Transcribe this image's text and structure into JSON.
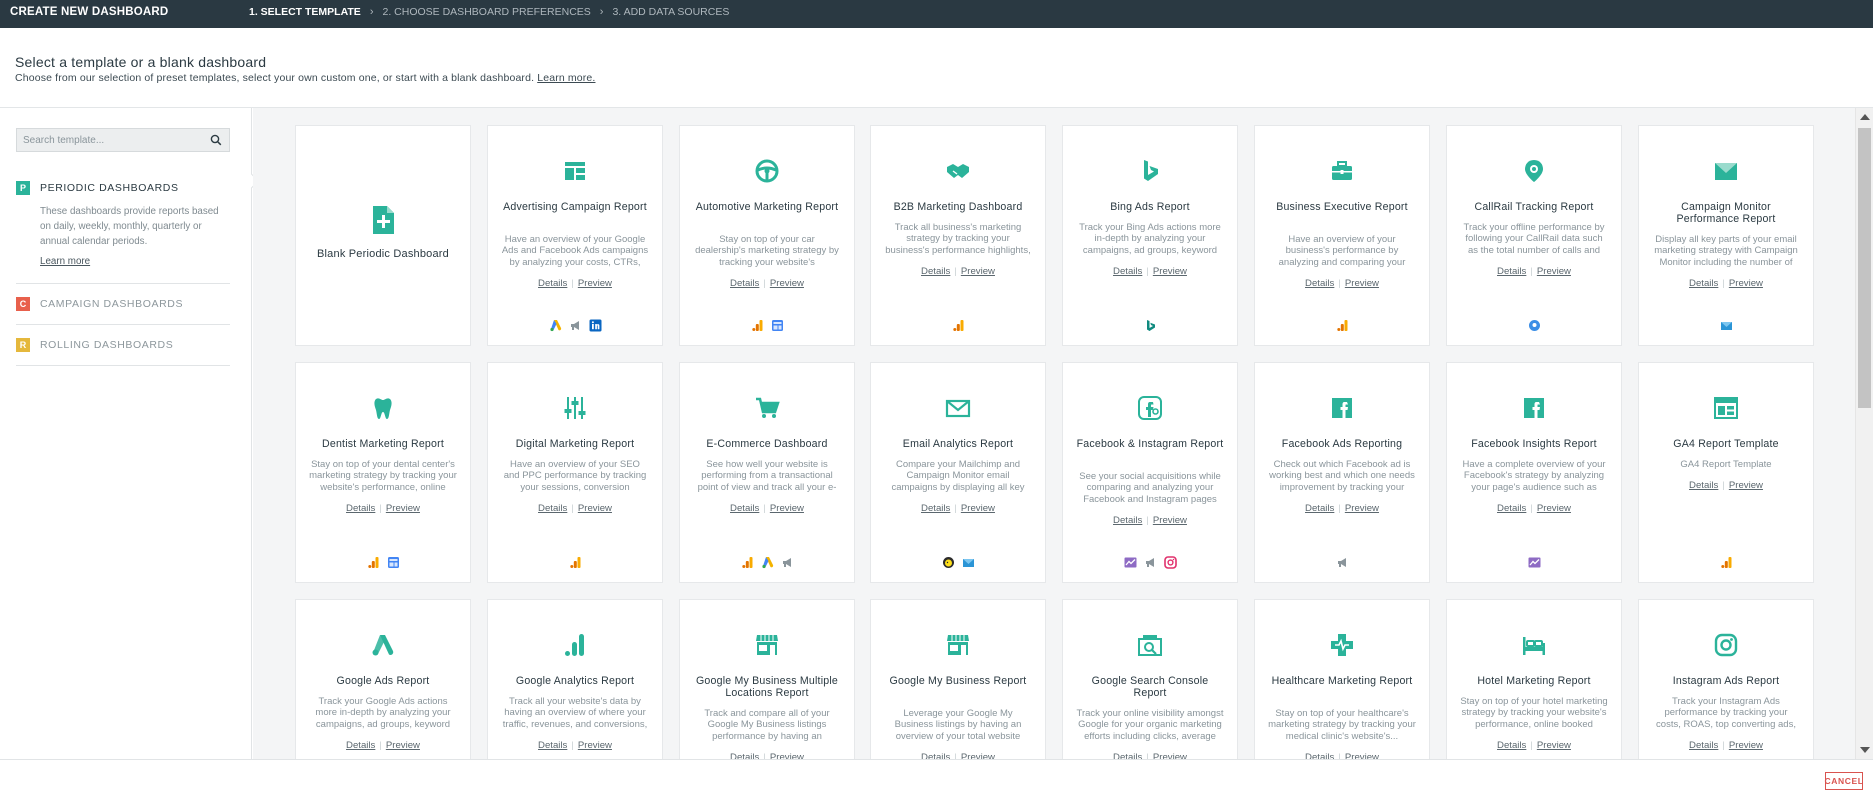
{
  "topbar": {
    "title": "CREATE NEW DASHBOARD",
    "steps": [
      "1. SELECT TEMPLATE",
      "2. CHOOSE DASHBOARD PREFERENCES",
      "3. ADD DATA SOURCES"
    ]
  },
  "header": {
    "heading": "Select a template or a blank dashboard",
    "subheading": "Choose from our selection of preset templates, select your own custom one, or start with a blank dashboard.",
    "learn_more": "Learn more."
  },
  "sidebar": {
    "search_placeholder": "Search template...",
    "categories": [
      {
        "badge": "P",
        "label": "PERIODIC DASHBOARDS",
        "color": "#2bb39a",
        "desc": "These dashboards provide reports based on daily, weekly, monthly, quarterly or annual calendar periods.",
        "learn": "Learn more"
      },
      {
        "badge": "C",
        "label": "CAMPAIGN DASHBOARDS",
        "color": "#e8604c"
      },
      {
        "badge": "R",
        "label": "ROLLING DASHBOARDS",
        "color": "#e5b83c"
      }
    ]
  },
  "colors": {
    "accent": "#2bb39a",
    "topbar": "#2a3942",
    "cancel": "#d9534f"
  },
  "links": {
    "details": "Details",
    "preview": "Preview"
  },
  "blank": {
    "title": "Blank Periodic Dashboard",
    "icon": "file-plus-icon"
  },
  "templates": [
    {
      "title": "Advertising Campaign Report",
      "desc": "Have an overview of your Google Ads and Facebook Ads campaigns by analyzing your costs, CTRs, conversion rates...",
      "icon": "dashboard-layout-icon",
      "sources": [
        "google-ads",
        "megaphone",
        "linkedin"
      ]
    },
    {
      "title": "Automotive Marketing Report",
      "desc": "Stay on top of your car dealership's marketing strategy by tracking your website's performance, lead acquisition...",
      "icon": "steering-wheel-icon",
      "sources": [
        "analytics",
        "gmb"
      ]
    },
    {
      "title": "B2B Marketing Dashboard",
      "desc": "Track all business's marketing strategy by tracking your business's performance highlights, your website's...",
      "icon": "handshake-icon",
      "sources": [
        "analytics"
      ]
    },
    {
      "title": "Bing Ads Report",
      "desc": "Track your Bing Ads actions more in-depth by analyzing your campaigns, ad groups, keyword performance and...",
      "icon": "bing-icon",
      "sources": [
        "bing"
      ]
    },
    {
      "title": "Business Executive Report",
      "desc": "Have an overview of your business's performance by analyzing and comparing your most important metrics and...",
      "icon": "briefcase-icon",
      "sources": [
        "analytics"
      ]
    },
    {
      "title": "CallRail Tracking Report",
      "desc": "Track your offline performance by following your CallRail data such as the total number of calls and answered calls, the...",
      "icon": "map-pin-icon",
      "sources": [
        "callrail"
      ]
    },
    {
      "title": "Campaign Monitor Performance Report",
      "desc": "Display all key parts of your email marketing strategy with Campaign Monitor including the number of emails sent,...",
      "icon": "campaign-monitor-icon",
      "sources": [
        "campaign-monitor"
      ]
    },
    {
      "title": "Dentist Marketing Report",
      "desc": "Stay on top of your dental center's marketing strategy by tracking your website's performance, online booked...",
      "icon": "tooth-icon",
      "sources": [
        "analytics",
        "gmb"
      ]
    },
    {
      "title": "Digital Marketing Report",
      "desc": "Have an overview of your SEO and PPC performance by tracking your sessions, conversion revenue, costs and...",
      "icon": "sliders-icon",
      "sources": [
        "analytics"
      ]
    },
    {
      "title": "E-Commerce Dashboard",
      "desc": "See how well your website is performing from a transactional point of view and track all your e-commerce dat...",
      "icon": "shopping-cart-icon",
      "sources": [
        "analytics",
        "google-ads",
        "megaphone"
      ]
    },
    {
      "title": "Email Analytics Report",
      "desc": "Compare your Mailchimp and Campaign Monitor email campaigns by displaying all key parts of your email marketing...",
      "icon": "envelope-icon",
      "sources": [
        "mailchimp",
        "campaign-monitor"
      ]
    },
    {
      "title": "Facebook & Instagram Report",
      "desc": "See your social acquisitions while comparing and analyzing your Facebook and Instagram pages performances such as...",
      "icon": "facebook-instagram-icon",
      "sources": [
        "insights",
        "megaphone",
        "instagram"
      ]
    },
    {
      "title": "Facebook Ads Reporting",
      "desc": "Check out which Facebook ad is working best and which one needs improvement by tracking your campaigns...",
      "icon": "facebook-icon",
      "sources": [
        "megaphone"
      ]
    },
    {
      "title": "Facebook Insights Report",
      "desc": "Have a complete overview of your Facebook's strategy by analyzing your page's audience such as engagement rates,...",
      "icon": "facebook-icon",
      "sources": [
        "insights"
      ]
    },
    {
      "title": "GA4 Report Template",
      "desc": "GA4 Report Template",
      "icon": "ga4-layout-icon",
      "sources": [
        "analytics"
      ]
    },
    {
      "title": "Google Ads Report",
      "desc": "Track your Google Ads actions more in-depth by analyzing your campaigns, ad groups, keyword performance and...",
      "icon": "google-ads-icon",
      "sources": []
    },
    {
      "title": "Google Analytics Report",
      "desc": "Track all your website's data by having an overview of where your traffic, revenues, and conversions, including your to...",
      "icon": "google-analytics-icon",
      "sources": []
    },
    {
      "title": "Google My Business Multiple Locations Report",
      "desc": "Track and compare all of your Google My Business listings performance by having an overview of your insights such...",
      "icon": "storefront-icon",
      "sources": []
    },
    {
      "title": "Google My Business Report",
      "desc": "Leverage your Google My Business listings by having an overview of your total website clicks, phone calls received,...",
      "icon": "storefront-icon",
      "sources": []
    },
    {
      "title": "Google Search Console Report",
      "desc": "Track your online visibility amongst Google for your organic marketing efforts including clicks, average CTRs,...",
      "icon": "search-console-icon",
      "sources": []
    },
    {
      "title": "Healthcare Marketing Report",
      "desc": "Stay on top of your healthcare's marketing strategy by tracking your medical clinic's website's...",
      "icon": "medical-cross-icon",
      "sources": []
    },
    {
      "title": "Hotel Marketing Report",
      "desc": "Stay on top of your hotel marketing strategy by tracking your website's performance, online booked reservations,...",
      "icon": "bed-icon",
      "sources": []
    },
    {
      "title": "Instagram Ads Report",
      "desc": "Track your Instagram Ads performance by tracking your costs, ROAS, top converting ads, posts likes and comments...",
      "icon": "instagram-icon",
      "sources": []
    }
  ],
  "footer": {
    "cancel": "CANCEL"
  }
}
